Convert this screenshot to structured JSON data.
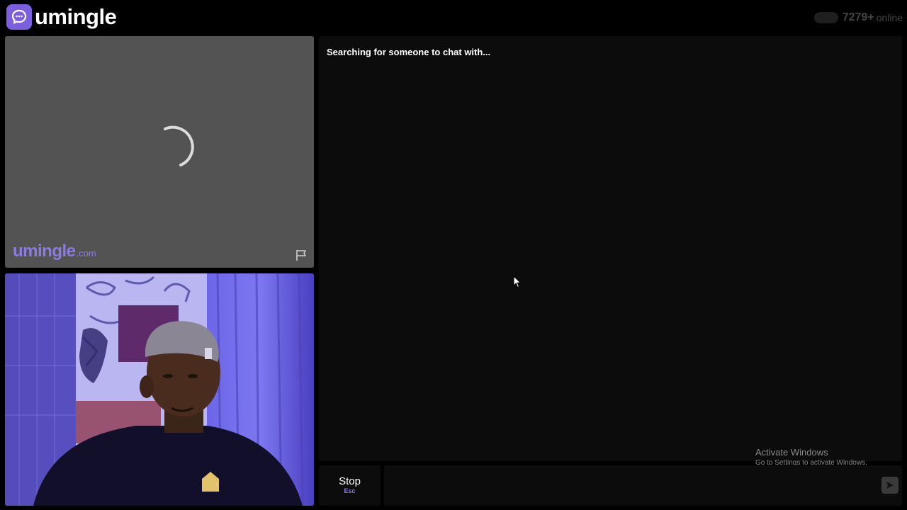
{
  "header": {
    "brand": "umingle",
    "online_count": "7279+",
    "online_label": "online"
  },
  "stranger_video": {
    "watermark_main": "umingle",
    "watermark_sub": ".com"
  },
  "chat": {
    "status_message": "Searching for someone to chat with..."
  },
  "controls": {
    "stop_label": "Stop",
    "stop_shortcut": "Esc",
    "message_placeholder": ""
  },
  "os_overlay": {
    "title": "Activate Windows",
    "subtitle": "Go to Settings to activate Windows."
  },
  "icons": {
    "logo": "chat-bubble-icon",
    "report": "flag-icon",
    "send": "send-icon",
    "loading": "spinner-icon"
  },
  "colors": {
    "accent": "#8c7ae6",
    "logo_badge": "#7b5fe0",
    "panel": "#0c0c0c",
    "video_placeholder": "#535353"
  }
}
